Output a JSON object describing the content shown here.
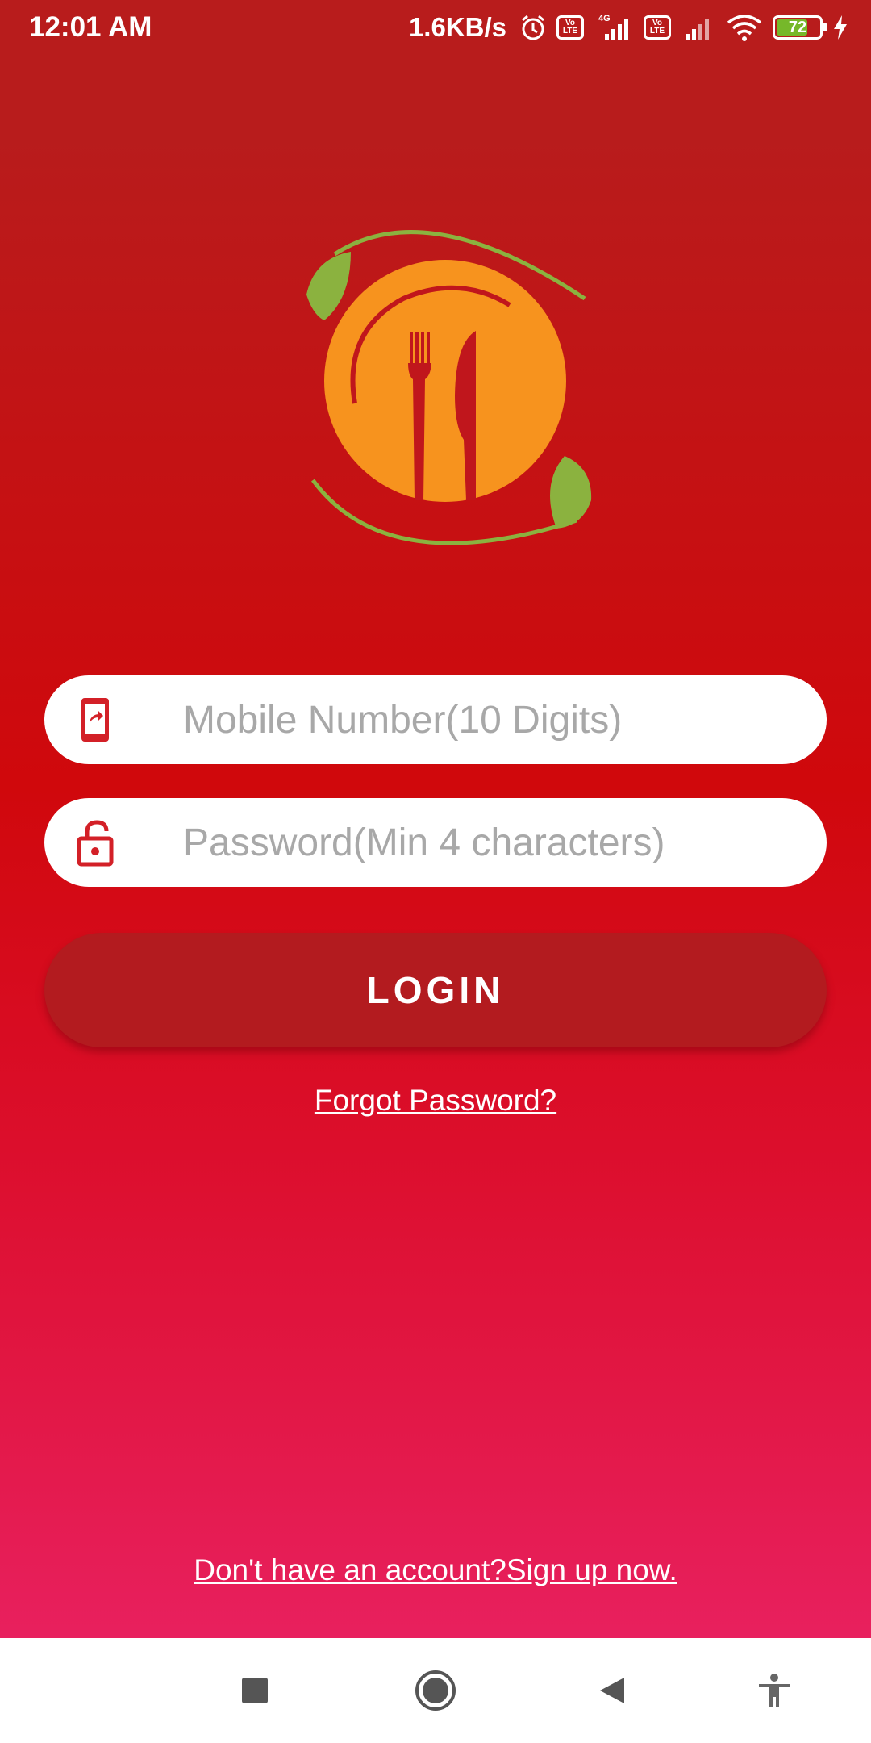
{
  "status_bar": {
    "time": "12:01 AM",
    "speed": "1.6KB/s",
    "network_type": "4G",
    "volte_label": "Vo LTE",
    "battery": "72",
    "icons": [
      "alarm-icon",
      "volte-icon",
      "signal-icon",
      "wifi-icon",
      "battery-icon",
      "charging-icon"
    ]
  },
  "colors": {
    "background_top": "#b81c1c",
    "background_bottom": "#e8205e",
    "accent": "#d32027",
    "button": "#b31b1f",
    "logo_orange": "#f7931e",
    "logo_green": "#8bb23f"
  },
  "login_form": {
    "mobile_placeholder": "Mobile Number(10 Digits)",
    "mobile_value": "",
    "password_placeholder": "Password(Min 4 characters)",
    "password_value": "",
    "login_label": "LOGIN",
    "forgot_label": "Forgot Password?",
    "signup_label": "Don't have an account?Sign up now."
  },
  "nav_bar": {
    "buttons": [
      "recents-icon",
      "home-icon",
      "back-icon",
      "accessibility-icon"
    ]
  }
}
